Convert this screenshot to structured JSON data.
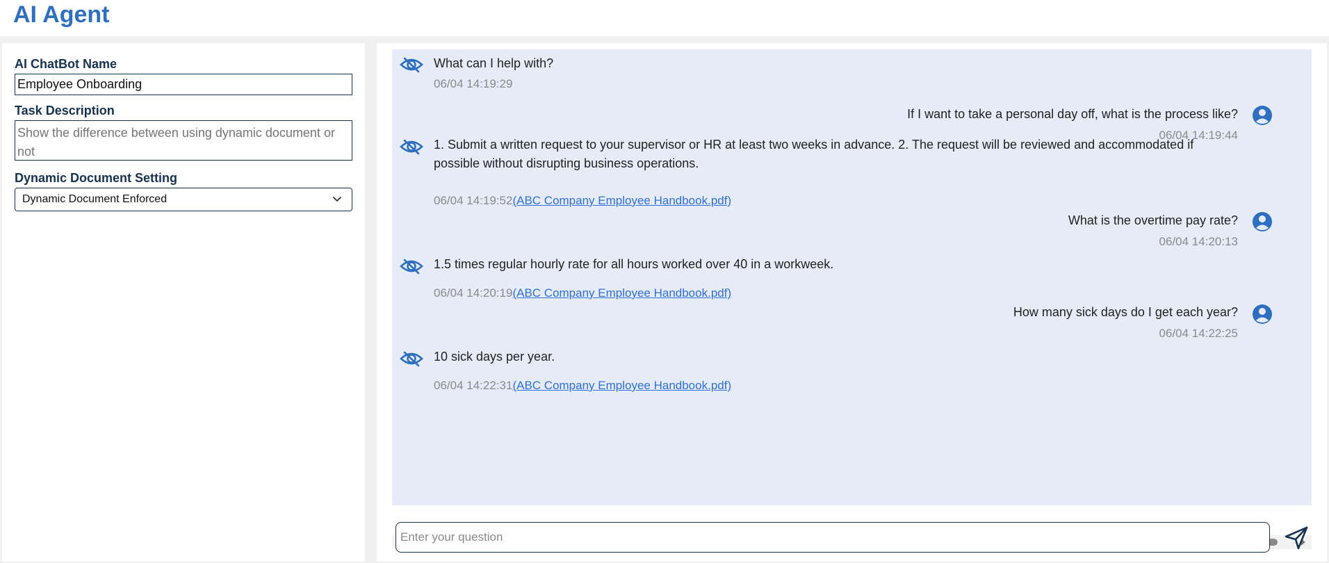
{
  "app": {
    "title": "AI Agent"
  },
  "settings": {
    "name_label": "AI ChatBot Name",
    "name_value": "Employee Onboarding",
    "task_label": "Task Description",
    "task_placeholder": "Show the difference between using dynamic document or not",
    "doc_label": "Dynamic Document Setting",
    "doc_selected": "Dynamic Document Enforced"
  },
  "chat": {
    "messages": [
      {
        "role": "bot",
        "text": "What can I help with?",
        "time": "06/04 14:19:29",
        "source": ""
      },
      {
        "role": "user",
        "text": "If I want to take a personal day off, what is the process like?",
        "time": "06/04 14:19:44"
      },
      {
        "role": "bot",
        "text": "1. Submit a written request to your supervisor or HR at least two weeks in advance. 2. The request will be reviewed and accommodated if possible without disrupting business operations.",
        "time": "06/04 14:19:52",
        "source": "(ABC Company Employee Handbook.pdf)"
      },
      {
        "role": "user",
        "text": "What is the overtime pay rate?",
        "time": "06/04 14:20:13"
      },
      {
        "role": "bot",
        "text": "1.5 times regular hourly rate for all hours worked over 40 in a workweek.",
        "time": "06/04 14:20:19",
        "source": "(ABC Company Employee Handbook.pdf)"
      },
      {
        "role": "user",
        "text": "How many sick days do I get each year?",
        "time": "06/04 14:22:25"
      },
      {
        "role": "bot",
        "text": "10 sick days per year.",
        "time": "06/04 14:22:31",
        "source": "(ABC Company Employee Handbook.pdf)"
      }
    ]
  },
  "input": {
    "placeholder": "Enter your question",
    "value": ""
  },
  "colors": {
    "accent": "#2f6fbf",
    "chat_bg": "#e5ecf7",
    "label": "#17324f",
    "link": "#2f6fd8"
  },
  "icons": {
    "bot": "eye-icon",
    "user": "user-avatar-icon",
    "send": "send-icon",
    "select": "chevron-down-icon"
  }
}
